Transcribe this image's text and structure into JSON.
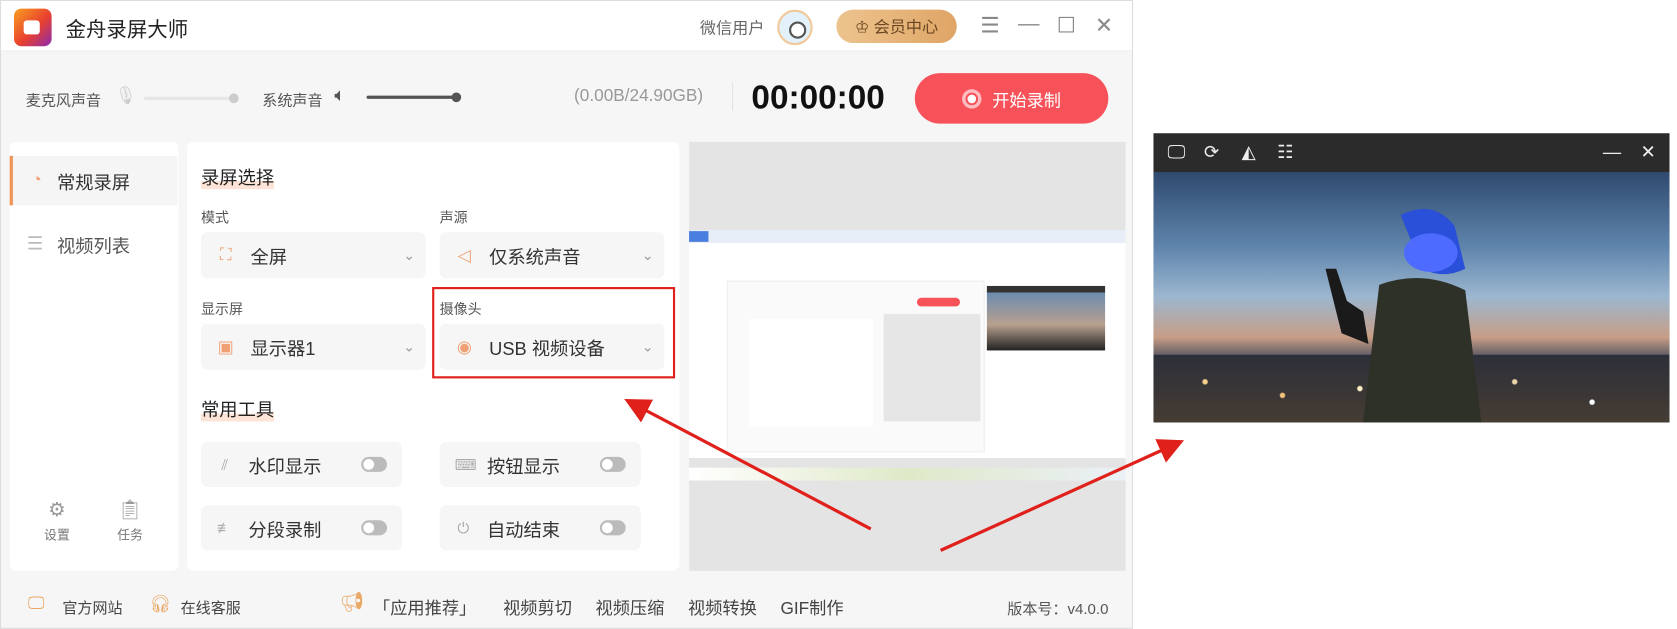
{
  "app": {
    "title": "金舟录屏大师",
    "user": "微信用户",
    "vip_label": "会员中心"
  },
  "audio": {
    "mic_label": "麦克风声音",
    "mic_level": 0,
    "system_label": "系统声音",
    "system_level": 1.0
  },
  "storage": "(0.00B/24.90GB)",
  "timer": "00:00:00",
  "record_button": "开始录制",
  "sidebar": {
    "items": [
      {
        "label": "常规录屏",
        "active": true
      },
      {
        "label": "视频列表",
        "active": false
      }
    ],
    "settings": "设置",
    "tasks": "任务"
  },
  "record_options": {
    "heading": "录屏选择",
    "mode": {
      "label": "模式",
      "value": "全屏"
    },
    "audio_source": {
      "label": "声源",
      "value": "仅系统声音"
    },
    "display": {
      "label": "显示屏",
      "value": "显示器1"
    },
    "camera": {
      "label": "摄像头",
      "value": "USB 视频设备"
    }
  },
  "tools": {
    "heading": "常用工具",
    "items": [
      {
        "label": "水印显示",
        "on": false
      },
      {
        "label": "按钮显示",
        "on": false
      },
      {
        "label": "分段录制",
        "on": false
      },
      {
        "label": "自动结束",
        "on": false
      }
    ]
  },
  "footer": {
    "website": "官方网站",
    "support": "在线客服",
    "recommend": "「应用推荐」",
    "links": [
      "视频剪切",
      "视频压缩",
      "视频转换",
      "GIF制作"
    ],
    "version": "版本号：v4.0.0"
  },
  "colors": {
    "accent": "#f7525a",
    "orange": "#f0945a",
    "annotation": "#e0201b"
  }
}
